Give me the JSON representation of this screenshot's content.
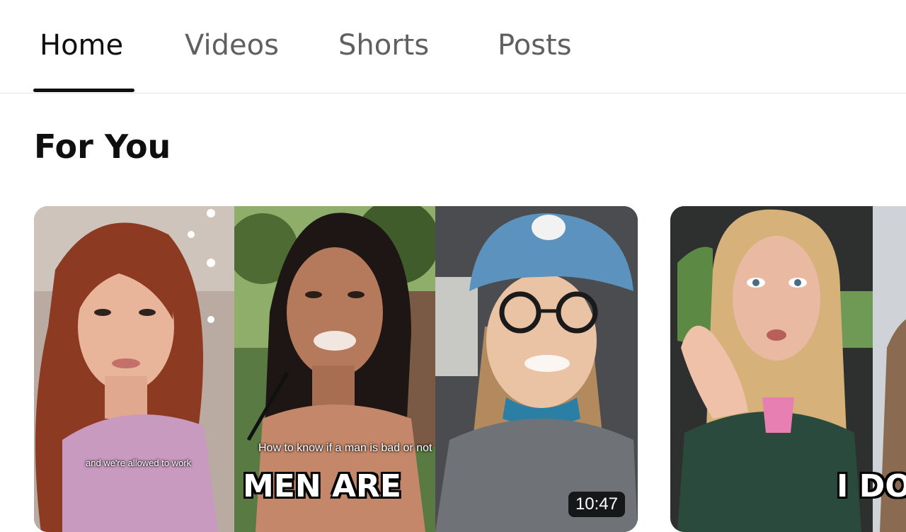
{
  "tabs": {
    "home": "Home",
    "videos": "Videos",
    "shorts": "Shorts",
    "posts": "Posts"
  },
  "section": {
    "title": "For You"
  },
  "cards": [
    {
      "caption_1": "and we're allowed to work",
      "caption_2": "How to know if a man is bad or not",
      "headline": "MEN ARE",
      "duration": "10:47"
    },
    {
      "headline": "I DO"
    }
  ]
}
